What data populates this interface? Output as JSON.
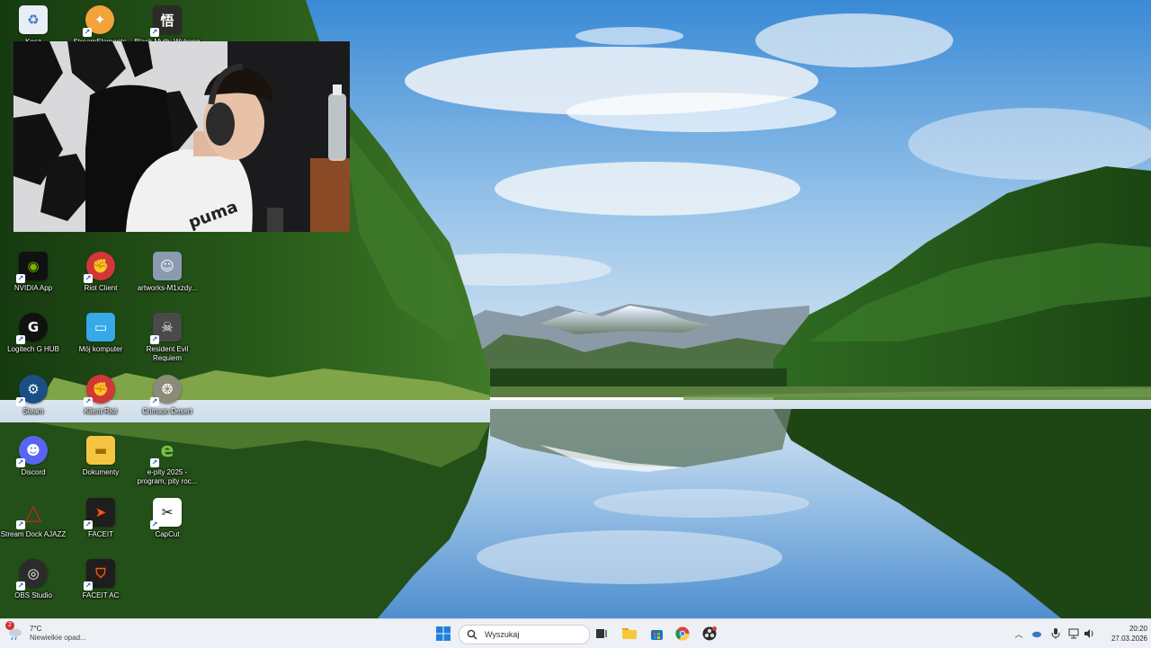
{
  "desktop": {
    "icons": [
      {
        "label": "Kosz",
        "icon": "recycle-bin-icon",
        "color": "#5b8fd6"
      },
      {
        "label": "StreamElements",
        "icon": "streamelements-icon",
        "color": "#f2a33a"
      },
      {
        "label": "Black Myth: Wukong",
        "icon": "black-myth-wukong-icon",
        "color": "#2d2b28"
      },
      {
        "label": "NVIDIA App",
        "icon": "nvidia-icon",
        "color": "#1b1b1b"
      },
      {
        "label": "Riot Client",
        "icon": "riot-client-icon",
        "color": "#d13639"
      },
      {
        "label": "artworks-M1xzdy...",
        "icon": "artwork-image-icon",
        "color": "#8a9bb0"
      },
      {
        "label": "Logitech G HUB",
        "icon": "logitech-ghub-icon",
        "color": "#111111"
      },
      {
        "label": "Mój komputer",
        "icon": "my-computer-icon",
        "color": "#37a8e8"
      },
      {
        "label": "Resident Evil Requiem",
        "icon": "resident-evil-icon",
        "color": "#4a4a4a"
      },
      {
        "label": "Steam",
        "icon": "steam-icon",
        "color": "#1b4f84"
      },
      {
        "label": "Klient Riot",
        "icon": "riot-client-icon",
        "color": "#d13639"
      },
      {
        "label": "Crimson Desert",
        "icon": "crimson-desert-icon",
        "color": "#8b8b78"
      },
      {
        "label": "Discord",
        "icon": "discord-icon",
        "color": "#5865f2"
      },
      {
        "label": "Dokumenty",
        "icon": "folder-icon",
        "color": "#f4c542"
      },
      {
        "label": "e-pity 2025 - program, pity roc...",
        "icon": "e-pity-icon",
        "color": "#7ac143"
      },
      {
        "label": "Stream Dock AJAZZ",
        "icon": "stream-dock-icon",
        "color": "#c62828"
      },
      {
        "label": "FACEIT",
        "icon": "faceit-icon",
        "color": "#1e1e1e"
      },
      {
        "label": "CapCut",
        "icon": "capcut-icon",
        "color": "#ffffff"
      },
      {
        "label": "OBS Studio",
        "icon": "obs-icon",
        "color": "#2b2b2b"
      },
      {
        "label": "FACEIT AC",
        "icon": "faceit-ac-icon",
        "color": "#1e1e1e"
      }
    ]
  },
  "taskbar": {
    "weather": {
      "temp": "7°C",
      "desc": "Niewielkie opad...",
      "badge": "2"
    },
    "search": {
      "placeholder": "Wyszukaj"
    },
    "apps": [
      "task-view-icon",
      "file-explorer-icon",
      "microsoft-store-icon",
      "chrome-icon",
      "obs-taskbar-icon"
    ],
    "clock": {
      "time": "20:20",
      "date": "27.03.2026"
    }
  },
  "colors": {
    "taskbar_bg": "#edf1f6",
    "sky_top": "#3f8fd8",
    "lake": "#7fb4e0",
    "forest": "#1f4a16"
  }
}
